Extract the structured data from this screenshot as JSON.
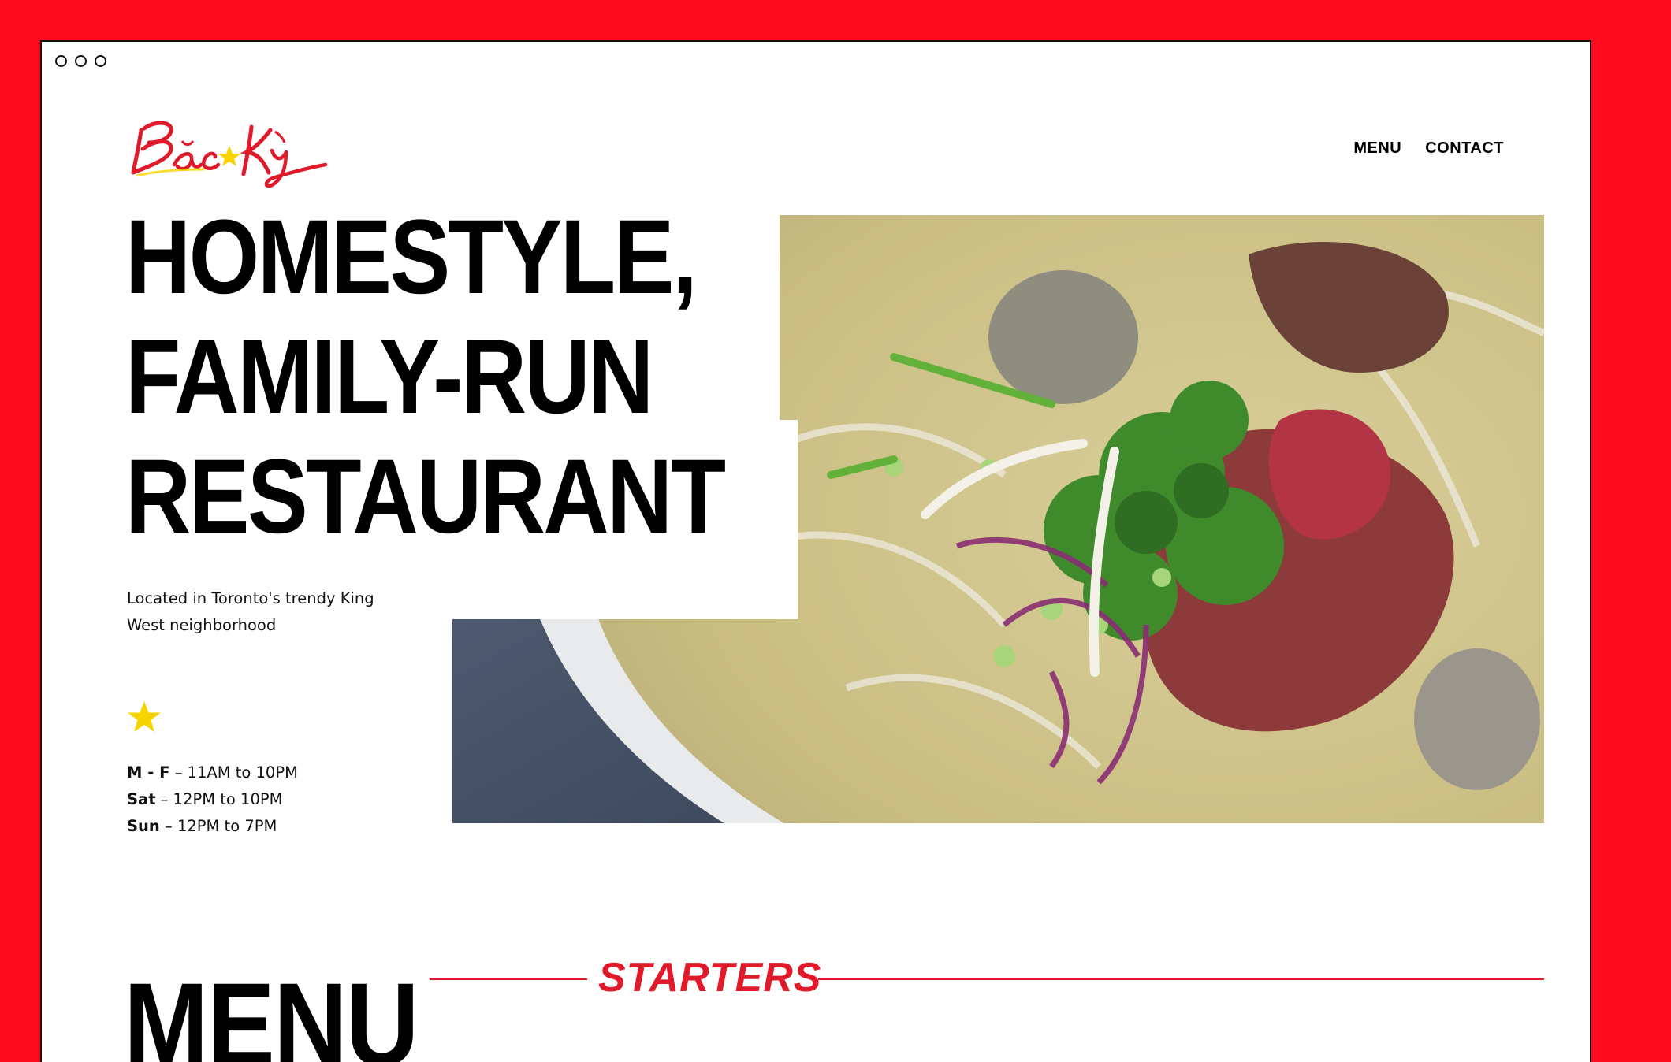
{
  "brand": {
    "logo_text": "Bắc★Kỳ"
  },
  "nav": {
    "menu": "MENU",
    "contact": "CONTACT"
  },
  "hero": {
    "headline_1": "HOMESTYLE,",
    "headline_2": "FAMILY-RUN",
    "headline_3": "RESTAURANT",
    "tagline": "Located in Toronto's trendy King West neighborhood",
    "image_alt": "Bowl of pho with beef, meatballs, onions and herbs"
  },
  "hours": [
    {
      "day": "M - F",
      "time": " – 11AM to 10PM"
    },
    {
      "day": "Sat",
      "time": " – 12PM to 10PM"
    },
    {
      "day": "Sun",
      "time": " – 12PM to 7PM"
    }
  ],
  "menu": {
    "heading": "MENU",
    "section": "STARTERS"
  },
  "colors": {
    "brand_red": "#ff0a1f",
    "accent_red": "#e01a2b",
    "star_yellow": "#f7d400"
  }
}
